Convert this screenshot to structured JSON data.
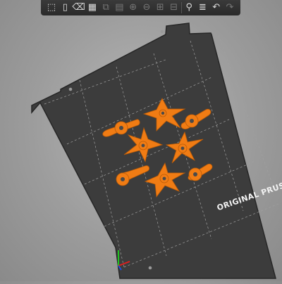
{
  "toolbar": {
    "buttons": [
      {
        "name": "add-object-icon",
        "glyph": "⬚",
        "enabled": true
      },
      {
        "name": "delete-icon",
        "glyph": "▯",
        "enabled": true
      },
      {
        "name": "delete-all-icon",
        "glyph": "⌫",
        "enabled": true
      },
      {
        "name": "arrange-icon",
        "glyph": "▦",
        "enabled": true
      },
      {
        "name": "copy-icon",
        "glyph": "⧉",
        "enabled": false
      },
      {
        "name": "paste-icon",
        "glyph": "▤",
        "enabled": false
      },
      {
        "name": "add-instance-icon",
        "glyph": "⊕",
        "enabled": false
      },
      {
        "name": "remove-instance-icon",
        "glyph": "⊖",
        "enabled": false
      },
      {
        "name": "split-objects-icon",
        "glyph": "⊞",
        "enabled": false
      },
      {
        "name": "split-parts-icon",
        "glyph": "⊟",
        "enabled": false
      },
      {
        "name": "search-icon",
        "glyph": "🔍",
        "enabled": true
      },
      {
        "name": "layers-icon",
        "glyph": "≣",
        "enabled": true
      },
      {
        "name": "undo-icon",
        "glyph": "↶",
        "enabled": true
      },
      {
        "name": "redo-icon",
        "glyph": "↷",
        "enabled": false
      }
    ]
  },
  "plate": {
    "label": "ORIGINAL PRUSA M",
    "surface_color": "#3c3c3c",
    "edge_color": "#2b2b2b",
    "grid_color": "#9a9a9a"
  },
  "parts": {
    "color": "#f07c14",
    "edge_color": "#b85a08"
  },
  "axes": {
    "x_color": "#e02020",
    "y_color": "#20c020",
    "z_color": "#2050e0"
  }
}
